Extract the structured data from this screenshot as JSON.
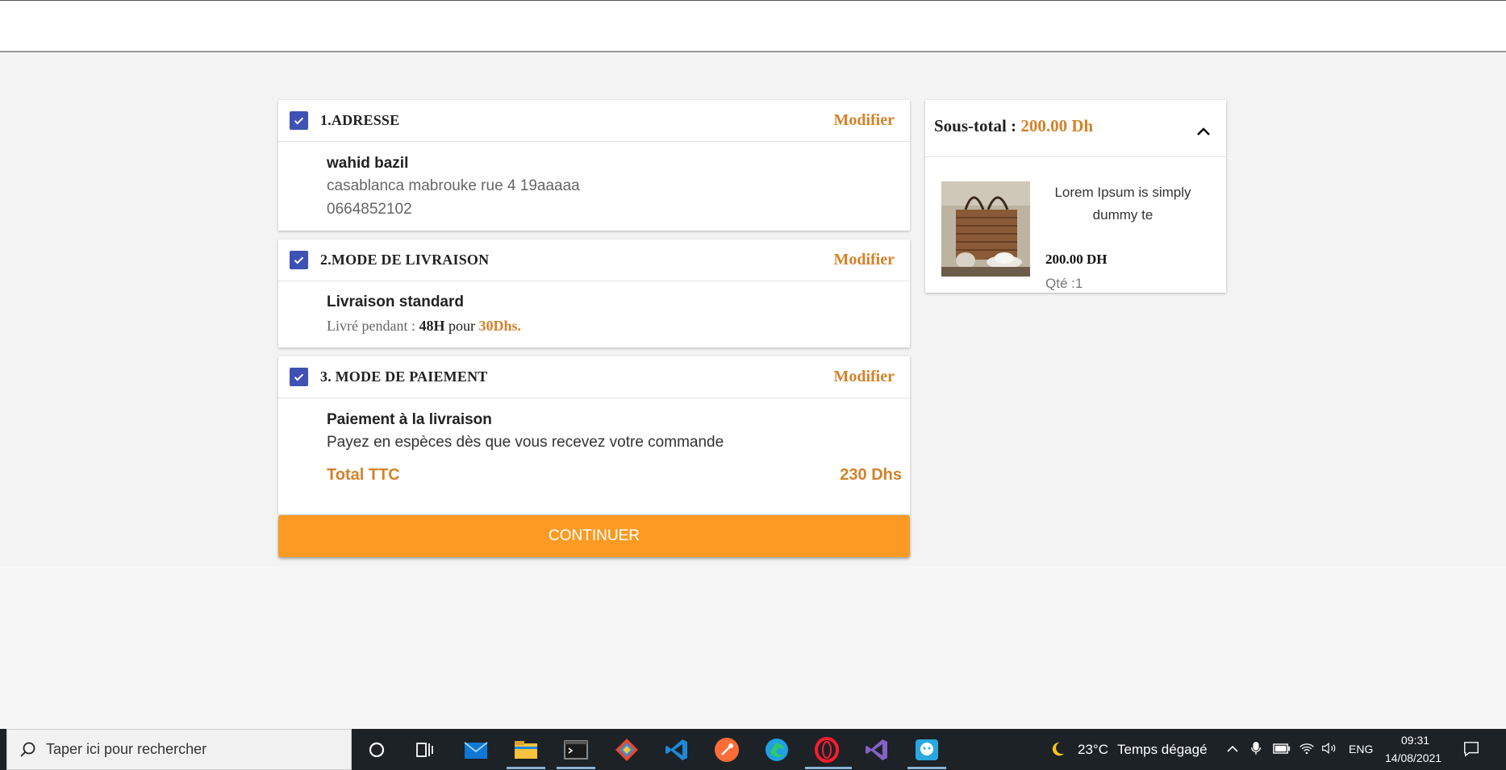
{
  "checkout": {
    "address": {
      "title": "1.ADRESSE",
      "modify": "Modifier",
      "name": "wahid bazil",
      "street": "casablanca mabrouke rue 4 19aaaaa",
      "phone": "0664852102"
    },
    "delivery": {
      "title": "2.MODE DE LIVRAISON",
      "modify": "Modifier",
      "method": "Livraison standard",
      "delay_prefix": "Livré pendant : ",
      "delay": "48H",
      "price_prefix": " pour ",
      "price": "30Dhs."
    },
    "payment": {
      "title": "3. MODE DE PAIEMENT",
      "modify": "Modifier",
      "method": "Paiement à la livraison",
      "description": "Payez en espèces dès que vous recevez votre commande",
      "total_label": "Total TTC",
      "total_value": "230 Dhs"
    },
    "continue_label": "CONTINUER"
  },
  "summary": {
    "subtotal_label": "Sous-total : ",
    "subtotal_value": "200.00 Dh",
    "product": {
      "name": "Lorem Ipsum is simply dummy te",
      "price": "200.00 DH",
      "qty": "Qté :1"
    }
  },
  "taskbar": {
    "search_placeholder": "Taper ici pour rechercher",
    "weather_temp": "23°C",
    "weather_text": "Temps dégagé",
    "language": "ENG",
    "time": "09:31",
    "date": "14/08/2021",
    "icons": [
      "cortana-icon",
      "task-view-icon",
      "mail-icon",
      "file-explorer-icon",
      "terminal-icon",
      "git-icon",
      "vscode-icon",
      "postman-icon",
      "edge-icon",
      "opera-icon",
      "visual-studio-icon",
      "chat-app-icon"
    ]
  },
  "colors": {
    "accent_orange": "#d4822a",
    "button_orange": "#fb9b24",
    "checkbox_blue": "#3f51b5",
    "taskbar": "#1d2227"
  }
}
